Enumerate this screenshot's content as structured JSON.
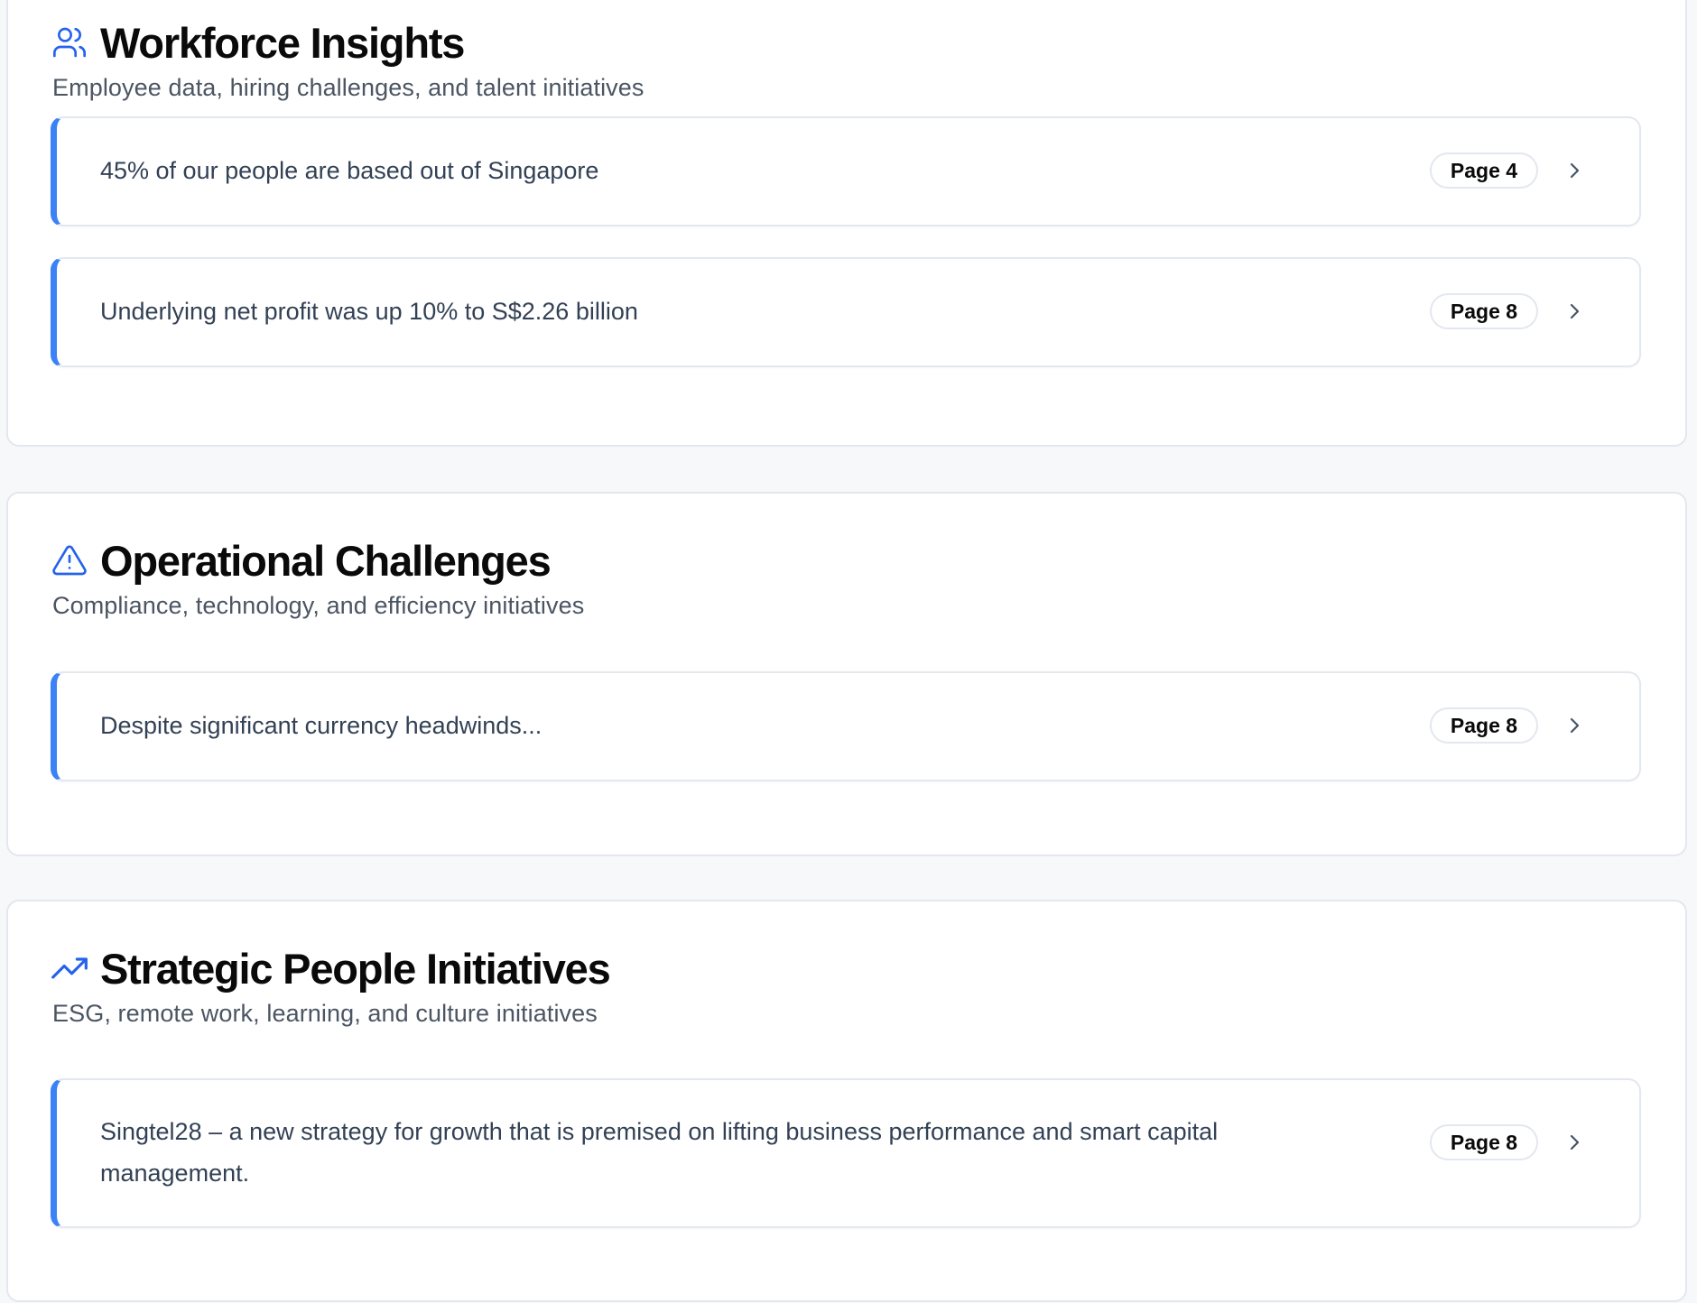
{
  "colors": {
    "accent": "#3b82f6",
    "icon": "#2563eb",
    "card_border": "#e3e7ee",
    "background": "#f7f8fa",
    "subtitle": "#4b5563",
    "item_text": "#334155"
  },
  "sections": [
    {
      "icon": "users-icon",
      "title": "Workforce Insights",
      "subtitle": "Employee data, hiring challenges, and talent initiatives",
      "items": [
        {
          "text": "45% of our people are based out of Singapore",
          "page": "Page 4"
        },
        {
          "text": "Underlying net profit was up 10% to S$2.26 billion",
          "page": "Page 8"
        }
      ]
    },
    {
      "icon": "warning-triangle-icon",
      "title": "Operational Challenges",
      "subtitle": "Compliance, technology, and efficiency initiatives",
      "items": [
        {
          "text": "Despite significant currency headwinds...",
          "page": "Page 8"
        }
      ]
    },
    {
      "icon": "trending-up-icon",
      "title": "Strategic People Initiatives",
      "subtitle": "ESG, remote work, learning, and culture initiatives",
      "items": [
        {
          "text": "Singtel28 – a new strategy for growth that is premised on lifting business performance and smart capital management.",
          "page": "Page 8"
        }
      ]
    }
  ]
}
